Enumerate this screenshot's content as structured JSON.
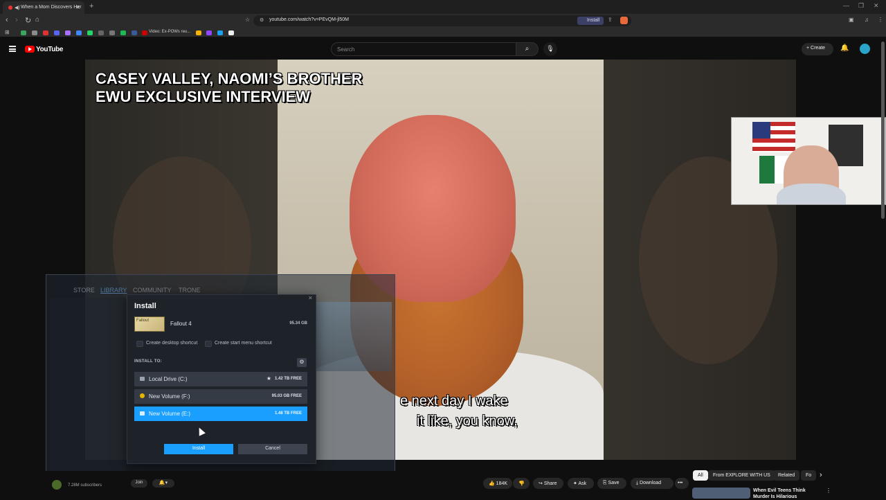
{
  "browser": {
    "tab_title": "When a Mom Discovers Her",
    "url": "youtube.com/watch?v=PEvQM-jl50M",
    "install_chip": "Install",
    "bookmark_text": "Video: Ex-POWs reu..."
  },
  "youtube": {
    "logo_text": "YouTube",
    "search_placeholder": "Search",
    "create_label": "Create"
  },
  "video": {
    "title_overlay_line1": "CASEY VALLEY, NAOMI’S BROTHER",
    "title_overlay_line2": "EWU EXCLUSIVE INTERVIEW",
    "subtitle_line1": "e next day I wake",
    "subtitle_line2": "it like, you know,"
  },
  "steam": {
    "nav": [
      "STORE",
      "LIBRARY",
      "COMMUNITY",
      "TRONE"
    ]
  },
  "install_dialog": {
    "title": "Install",
    "game_name": "Fallout 4",
    "game_thumb_text": "Fallout",
    "game_size": "95.34 GB",
    "checkbox_desktop": "Create desktop shortcut",
    "checkbox_startmenu": "Create start menu shortcut",
    "install_to_label": "INSTALL TO:",
    "drives": [
      {
        "name": "Local Drive (C:)",
        "free": "1.42 TB FREE"
      },
      {
        "name": "New Volume (F:)",
        "free": "95.03 GB FREE"
      },
      {
        "name": "New Volume (E:)",
        "free": "1.48 TB FREE"
      }
    ],
    "install_button": "Install",
    "cancel_button": "Cancel"
  },
  "below_video": {
    "subscribers": "7.28M subscribers",
    "join": "Join",
    "likes": "184K",
    "share": "Share",
    "ask": "Ask",
    "save": "Save",
    "download": "Download",
    "more": "•••"
  },
  "recommendations": {
    "chips": [
      "All",
      "From EXPLORE WITH US",
      "Related",
      "Fo"
    ],
    "first_title": "When Evil Teens Think Murder Is Hilarious"
  },
  "colors": {
    "steam_blue": "#1a9fff",
    "youtube_red": "#ff0000"
  }
}
